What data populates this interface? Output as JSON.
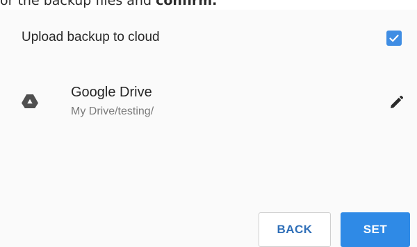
{
  "top_text": {
    "prefix": "or the backup files and ",
    "emphasis": "confirm."
  },
  "upload": {
    "label": "Upload backup to cloud",
    "checked": true
  },
  "drive": {
    "title": "Google Drive",
    "path": "My Drive/testing/",
    "icon": "google-drive-icon"
  },
  "actions": {
    "back_label": "BACK",
    "set_label": "SET"
  },
  "colors": {
    "accent": "#2f8ae6",
    "checkbox": "#3f8de3",
    "back_text": "#2f6fb8"
  }
}
